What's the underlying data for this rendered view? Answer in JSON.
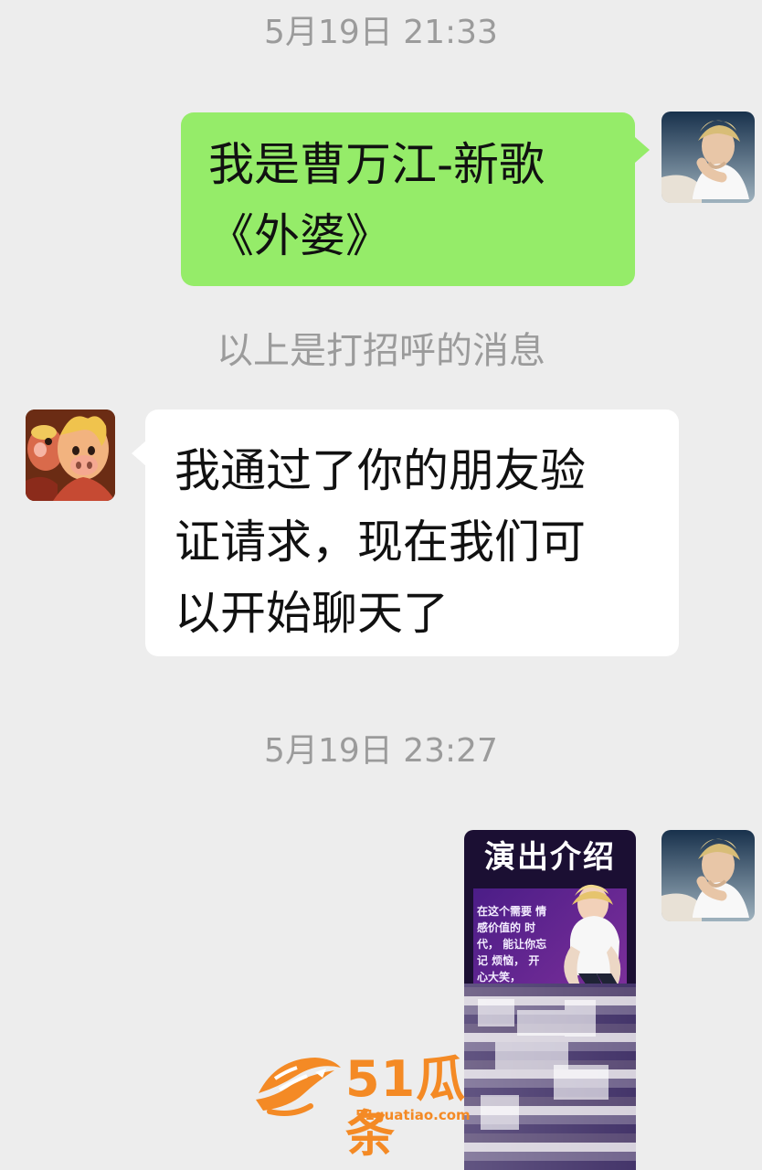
{
  "timestamps": {
    "first": "5月19日 21:33",
    "second": "5月19日 23:27"
  },
  "messages": {
    "sent_text": "我是曹万江-新歌\n《外婆》",
    "system_note": "以上是打招呼的消息",
    "received_text": "我通过了你的朋友验\n证请求，现在我们可\n以开始聊天了"
  },
  "poster": {
    "title": "演出介绍",
    "copy": "在这个需要\n情感价值的\n时代，\n能让你忘记\n烦恼，\n开心大笑，"
  },
  "watermark": {
    "main": "51瓜条",
    "sub": "51guatiao.com"
  },
  "colors": {
    "chat_background": "#ededed",
    "sent_bubble": "#95ec69",
    "received_bubble": "#ffffff",
    "system_text": "#9b9b9b",
    "watermark": "#f48a25"
  },
  "icons": {
    "sender_avatar": "portrait-avatar",
    "receiver_avatar": "cartoon-avatar",
    "watermark_logo": "fish-logo-icon"
  }
}
